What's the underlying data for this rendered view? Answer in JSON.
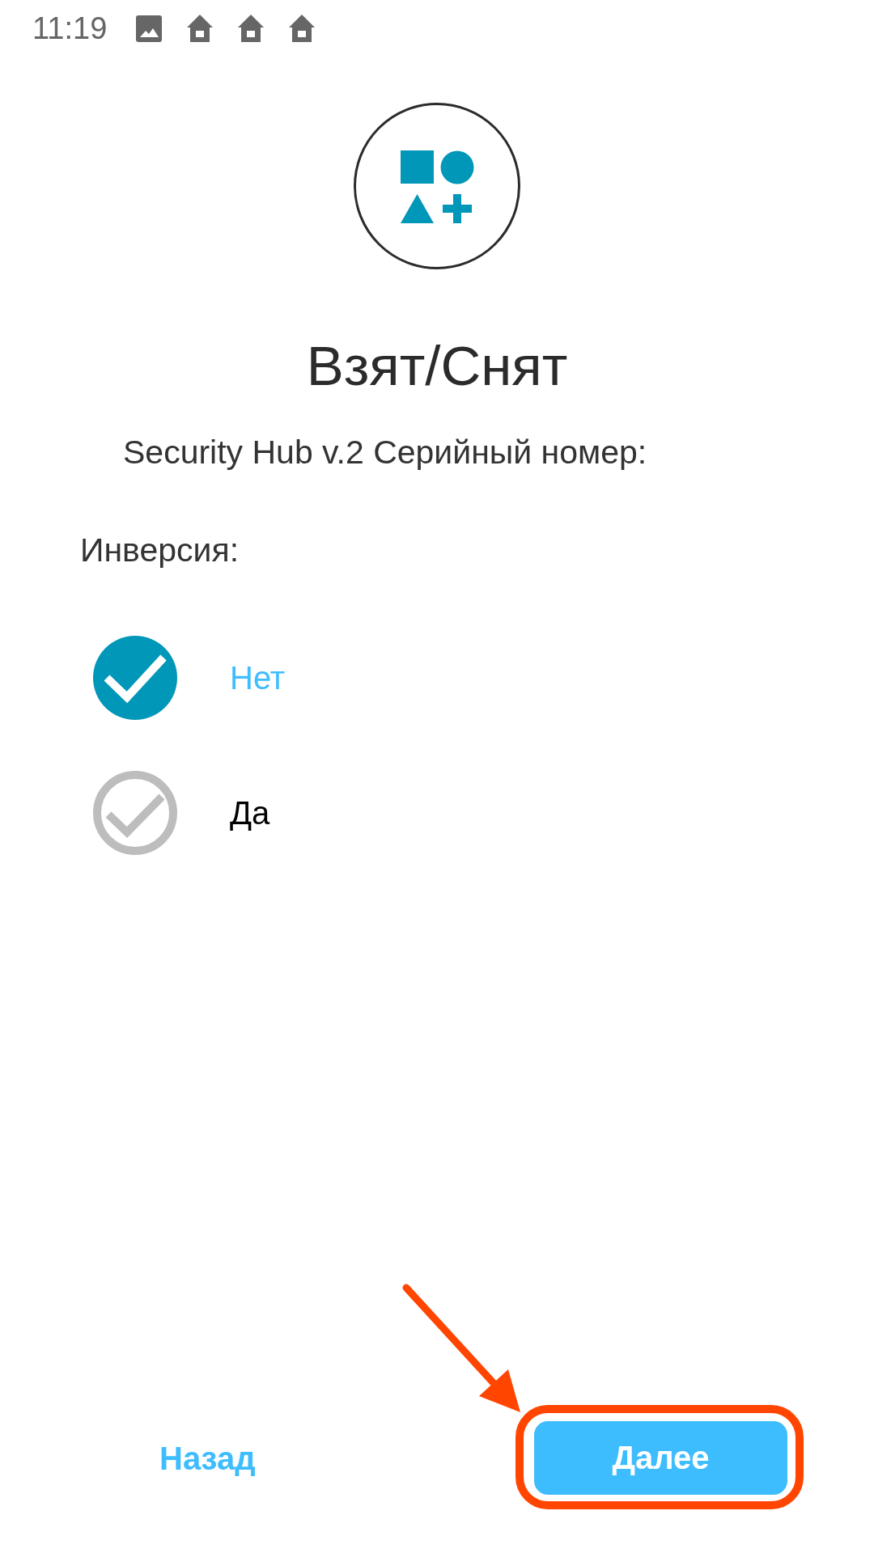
{
  "status_bar": {
    "time": "11:19"
  },
  "header": {
    "title": "Взят/Снят",
    "subtitle": "Security Hub v.2 Серийный номер:"
  },
  "inversion": {
    "label": "Инверсия:",
    "options": [
      {
        "label": "Нет",
        "selected": true
      },
      {
        "label": "Да",
        "selected": false
      }
    ]
  },
  "footer": {
    "back_button": "Назад",
    "next_button": {
      "label": "Далее",
      "highlighted": true
    }
  }
}
